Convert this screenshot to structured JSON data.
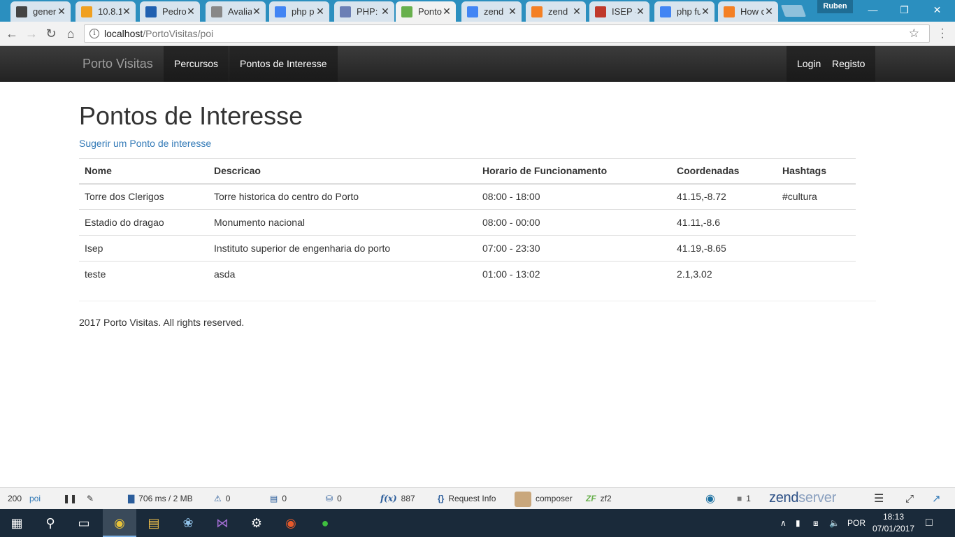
{
  "browser": {
    "tabs": [
      {
        "title": "gener",
        "favicon": "hash-icon",
        "color": "#444"
      },
      {
        "title": "10.8.1",
        "favicon": "pma-icon",
        "color": "#f0a020"
      },
      {
        "title": "Pedro",
        "favicon": "shield-icon",
        "color": "#2060b0"
      },
      {
        "title": "Avalia",
        "favicon": "document-icon",
        "color": "#888"
      },
      {
        "title": "php p",
        "favicon": "google-icon",
        "color": "#4285f4"
      },
      {
        "title": "PHP: d",
        "favicon": "php-icon",
        "color": "#6b7fb5"
      },
      {
        "title": "Ponto",
        "favicon": "zf-icon",
        "color": "#68b04d"
      },
      {
        "title": "zend",
        "favicon": "google-icon",
        "color": "#4285f4"
      },
      {
        "title": "zend",
        "favicon": "stackoverflow-icon",
        "color": "#f48024"
      },
      {
        "title": "ISEP -",
        "favicon": "isep-icon",
        "color": "#c0392b"
      },
      {
        "title": "php fu",
        "favicon": "google-icon",
        "color": "#4285f4"
      },
      {
        "title": "How c",
        "favicon": "stackoverflow-icon",
        "color": "#f48024"
      }
    ],
    "profile": "Ruben",
    "url_host": "localhost",
    "url_path": "/PortoVisitas/poi"
  },
  "site": {
    "brand": "Porto Visitas",
    "nav": {
      "percursos": "Percursos",
      "pontos": "Pontos de Interesse",
      "login": "Login",
      "registo": "Registo"
    },
    "page_title": "Pontos de Interesse",
    "suggest_link": "Sugerir um Ponto de interesse",
    "table": {
      "headers": [
        "Nome",
        "Descricao",
        "Horario de Funcionamento",
        "Coordenadas",
        "Hashtags"
      ],
      "rows": [
        [
          "Torre dos Clerigos",
          "Torre historica do centro do Porto",
          "08:00 - 18:00",
          "41.15,-8.72",
          "#cultura"
        ],
        [
          "Estadio do dragao",
          "Monumento nacional",
          "08:00 - 00:00",
          "41.11,-8.6",
          ""
        ],
        [
          "Isep",
          "Instituto superior de engenharia do porto",
          "07:00 - 23:30",
          "41.19,-8.65",
          ""
        ],
        [
          "teste",
          "asda",
          "01:00 - 13:02",
          "2.1,3.02",
          ""
        ]
      ]
    },
    "footer": "2017 Porto Visitas. All rights reserved."
  },
  "zendbar": {
    "status": "200",
    "route": "poi",
    "timing": "706 ms / 2 MB",
    "warnings": "0",
    "logs": "0",
    "db": "0",
    "functions": "887",
    "request_info": "Request Info",
    "composer": "composer",
    "zf2": "zf2",
    "messages": "1",
    "logo_zend": "zend",
    "logo_server": "server"
  },
  "taskbar": {
    "language": "POR",
    "time": "18:13",
    "date": "07/01/2017"
  }
}
